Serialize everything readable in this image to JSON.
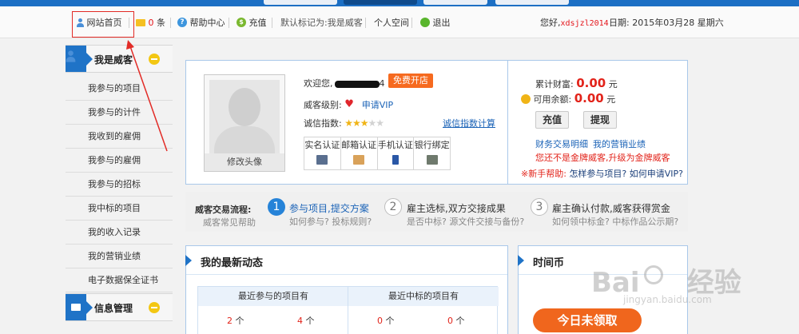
{
  "toolbar": {
    "home": "网站首页",
    "msg_count": "0",
    "msg_unit": "条",
    "help": "帮助中心",
    "recharge": "充值",
    "default_mark": "默认标记为:我是威客",
    "space": "个人空间",
    "logout": "退出",
    "greeting": "您好,",
    "username": "xdsjzl2014",
    "date_label": "日期:",
    "date": "2015年03月28 星期六"
  },
  "sidebar": {
    "section1_title": "我是威客",
    "items": [
      "我参与的项目",
      "我参与的计件",
      "我收到的雇佣",
      "我参与的雇佣",
      "我参与的招标",
      "我中标的项目",
      "我的收入记录",
      "我的营销业绩",
      "电子数据保全证书"
    ],
    "section2_title": "信息管理"
  },
  "profile": {
    "welcome": "欢迎您,",
    "username_suffix": "4",
    "free_open": "免费开店",
    "level_label": "威客级别:",
    "apply_vip": "申请VIP",
    "credit_label": "诚信指数:",
    "credit_calc": "诚信指数计算",
    "avatar_caption": "修改头像",
    "verifications": [
      "实名认证",
      "邮箱认证",
      "手机认证",
      "银行绑定"
    ]
  },
  "wealth": {
    "total_label": "累计财富:",
    "total_value": "0.00",
    "balance_label": "可用余额:",
    "balance_value": "0.00",
    "unit": "元",
    "recharge_btn": "充值",
    "withdraw_btn": "提现",
    "finance_link": "财务交易明细",
    "marketing_link": "我的营销业绩",
    "not_gold": "您还不是金牌威客,升级为金牌威客",
    "newbie": "※新手帮助:",
    "how_join": "怎样参与项目?",
    "how_vip": "如何申请VIP?"
  },
  "flow": {
    "title": "威客交易流程:",
    "faq": "威客常见帮助",
    "steps": [
      {
        "num": "1",
        "title": "参与项目,提交方案",
        "q1": "如何参与?",
        "q2": "投标规则?"
      },
      {
        "num": "2",
        "title": "雇主选标,双方交接成果",
        "q1": "是否中标?",
        "q2": "源文件交接与备份?"
      },
      {
        "num": "3",
        "title": "雇主确认付款,威客获得赏金",
        "q1": "如何领中标金?",
        "q2": "中标作品公示期?"
      }
    ]
  },
  "activity": {
    "title": "我的最新动态",
    "col1": "最近参与的项目有",
    "col2": "最近中标的项目有",
    "v1": "2",
    "v2": "4",
    "v3": "0",
    "v4": "0",
    "unit": "个"
  },
  "timecoin": {
    "title": "时间币",
    "claim": "今日未领取"
  },
  "watermark": {
    "brand": "Bai",
    "brand2": "经验",
    "url": "jingyan.baidu.com"
  }
}
